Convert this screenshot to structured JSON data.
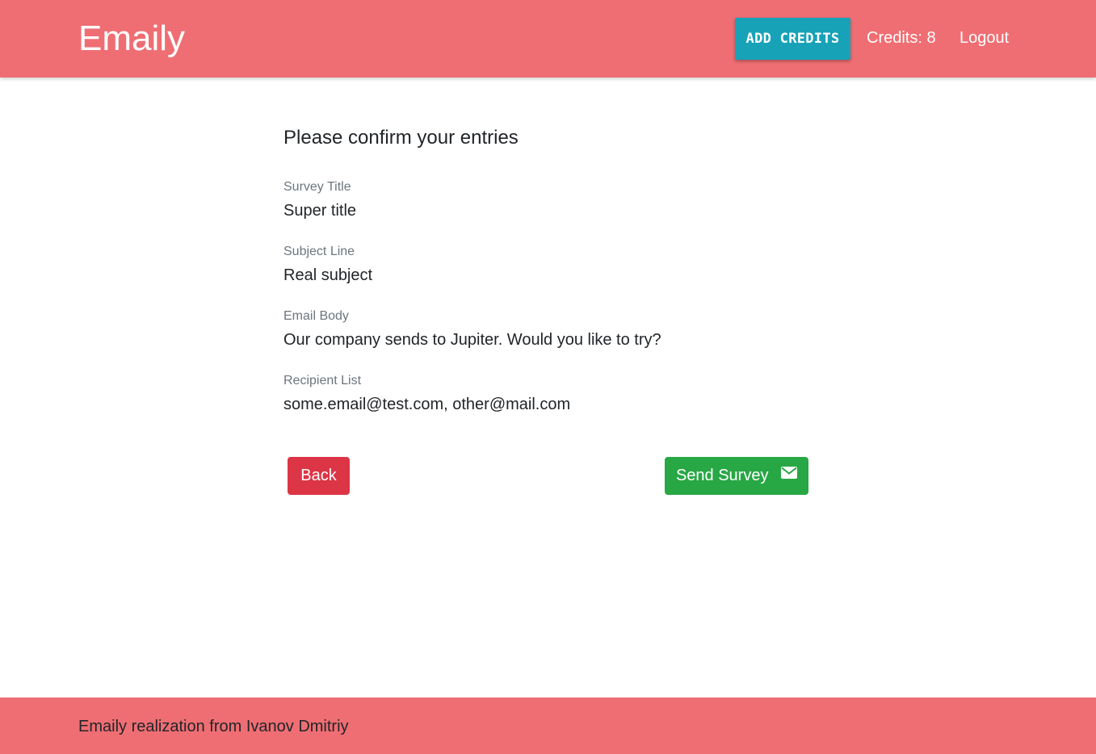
{
  "header": {
    "brand": "Emaily",
    "add_credits_label": "ADD CREDITS",
    "credits_text": "Credits: 8",
    "logout_label": "Logout"
  },
  "main": {
    "heading": "Please confirm your entries",
    "fields": [
      {
        "label": "Survey Title",
        "value": "Super title"
      },
      {
        "label": "Subject Line",
        "value": "Real subject"
      },
      {
        "label": "Email Body",
        "value": "Our company sends to Jupiter. Would you like to try?"
      },
      {
        "label": "Recipient List",
        "value": "some.email@test.com, other@mail.com"
      }
    ],
    "back_label": "Back",
    "send_label": "Send Survey",
    "send_icon": "envelope-icon"
  },
  "footer": {
    "text": "Emaily realization from Ivanov Dmitriy"
  },
  "colors": {
    "header_bg": "#ef6e73",
    "add_credits_bg": "#17a2b8",
    "back_bg": "#dc3545",
    "send_bg": "#28a745"
  }
}
